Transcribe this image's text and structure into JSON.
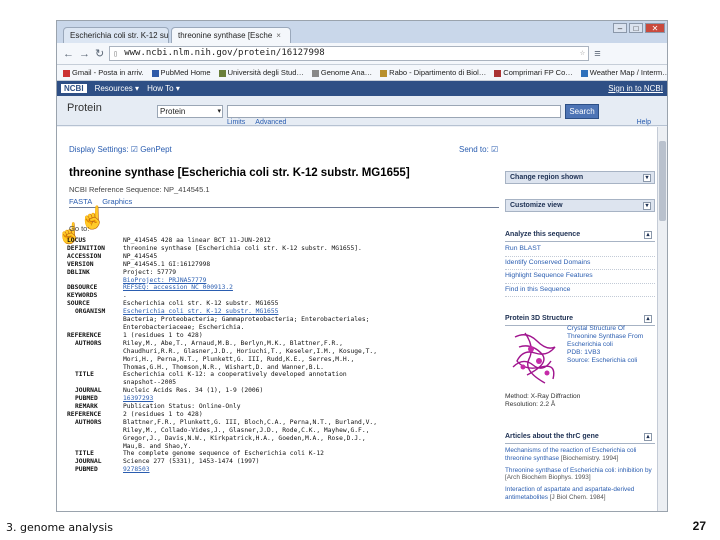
{
  "browser": {
    "tabs": [
      {
        "label": "Escherichia coli str. K-12 su",
        "active": false
      },
      {
        "label": "threonine synthase [Esche",
        "active": true
      }
    ],
    "url": "www.ncbi.nlm.nih.gov/protein/16127998",
    "window_buttons": [
      "–",
      "□",
      "✕"
    ],
    "bookmarks": [
      "Gmail - Posta in arriv.",
      "PubMed Home",
      "Università degli Stud…",
      "Genome Ana…",
      "Rabo - Dipartimento di Biol…",
      "Comprimari FP Co…",
      "Weather Map / Interm…"
    ]
  },
  "ncbi": {
    "logo": "NCBI",
    "resources": "Resources",
    "howto": "How To",
    "signin": "Sign in to NCBI",
    "db_title": "Protein",
    "db_select": "Protein",
    "search_button": "Search",
    "limits": "Limits",
    "advanced": "Advanced",
    "help": "Help"
  },
  "record": {
    "display_settings": "Display Settings: ☑ GenPept",
    "send_to": "Send to: ☑",
    "title": "threonine synthase [Escherichia coli str. K-12 substr. MG1655]",
    "ref_seq": "NCBI Reference Sequence: NP_414545.1",
    "formats": [
      "FASTA",
      "Graphics"
    ],
    "go_to": "Go to:",
    "genpept": [
      {
        "key": "LOCUS",
        "sub": false,
        "val": "NP_414545                 428 aa            linear   BCT 11-JUN-2012",
        "link": false
      },
      {
        "key": "DEFINITION",
        "sub": false,
        "val": "threonine synthase [Escherichia coli str. K-12 substr. MG1655].",
        "link": false
      },
      {
        "key": "ACCESSION",
        "sub": false,
        "val": "NP_414545",
        "link": false
      },
      {
        "key": "VERSION",
        "sub": false,
        "val": "NP_414545.1  GI:16127998",
        "link": false
      },
      {
        "key": "DBLINK",
        "sub": false,
        "val": "Project: 57779",
        "link": false
      },
      {
        "key": "",
        "sub": false,
        "val": "BioProject: PRJNA57779",
        "link": true
      },
      {
        "key": "DBSOURCE",
        "sub": false,
        "val": "REFSEQ: accession NC_000913.2",
        "link": true
      },
      {
        "key": "KEYWORDS",
        "sub": false,
        "val": ".",
        "link": false
      },
      {
        "key": "SOURCE",
        "sub": false,
        "val": "Escherichia coli str. K-12 substr. MG1655",
        "link": false
      },
      {
        "key": "ORGANISM",
        "sub": true,
        "val": "Escherichia coli str. K-12 substr. MG1655",
        "link": true
      },
      {
        "key": "",
        "sub": false,
        "val": "Bacteria; Proteobacteria; Gammaproteobacteria; Enterobacteriales;",
        "link": false
      },
      {
        "key": "",
        "sub": false,
        "val": "Enterobacteriaceae; Escherichia.",
        "link": false
      },
      {
        "key": "REFERENCE",
        "sub": false,
        "val": "1  (residues 1 to 428)",
        "link": false
      },
      {
        "key": "AUTHORS",
        "sub": true,
        "val": "Riley,M., Abe,T., Arnaud,M.B., Berlyn,M.K., Blattner,F.R.,",
        "link": false
      },
      {
        "key": "",
        "sub": false,
        "val": "Chaudhuri,R.R., Glasner,J.D., Horiuchi,T., Keseler,I.M., Kosuge,T.,",
        "link": false
      },
      {
        "key": "",
        "sub": false,
        "val": "Mori,H., Perna,N.T., Plunkett,G. III, Rudd,K.E., Serres,M.H.,",
        "link": false
      },
      {
        "key": "",
        "sub": false,
        "val": "Thomas,G.H., Thomson,N.R., Wishart,D. and Wanner,B.L.",
        "link": false
      },
      {
        "key": "TITLE",
        "sub": true,
        "val": "Escherichia coli K-12: a cooperatively developed annotation",
        "link": false
      },
      {
        "key": "",
        "sub": false,
        "val": "snapshot--2005",
        "link": false
      },
      {
        "key": "JOURNAL",
        "sub": true,
        "val": "Nucleic Acids Res. 34 (1), 1-9 (2006)",
        "link": false
      },
      {
        "key": "PUBMED",
        "sub": true,
        "val": "16397293",
        "link": true
      },
      {
        "key": "REMARK",
        "sub": true,
        "val": "Publication Status: Online-Only",
        "link": false
      },
      {
        "key": "REFERENCE",
        "sub": false,
        "val": "2  (residues 1 to 428)",
        "link": false
      },
      {
        "key": "AUTHORS",
        "sub": true,
        "val": "Blattner,F.R., Plunkett,G. III, Bloch,C.A., Perna,N.T., Burland,V.,",
        "link": false
      },
      {
        "key": "",
        "sub": false,
        "val": "Riley,M., Collado-Vides,J., Glasner,J.D., Rode,C.K., Mayhew,G.F.,",
        "link": false
      },
      {
        "key": "",
        "sub": false,
        "val": "Gregor,J., Davis,N.W., Kirkpatrick,H.A., Goeden,M.A., Rose,D.J.,",
        "link": false
      },
      {
        "key": "",
        "sub": false,
        "val": "Mau,B. and Shao,Y.",
        "link": false
      },
      {
        "key": "TITLE",
        "sub": true,
        "val": "The complete genome sequence of Escherichia coli K-12",
        "link": false
      },
      {
        "key": "JOURNAL",
        "sub": true,
        "val": "Science 277 (5331), 1453-1474 (1997)",
        "link": false
      },
      {
        "key": "PUBMED",
        "sub": true,
        "val": "9278503",
        "link": true
      }
    ]
  },
  "sidebar": {
    "change_region": "Change region shown",
    "customize_view": "Customize view",
    "analyze_head": "Analyze this sequence",
    "analyze_items": [
      "Run BLAST",
      "Identify Conserved Domains",
      "Highlight Sequence Features",
      "Find in this Sequence"
    ],
    "structure_head": "Protein 3D Structure",
    "structure_text": "Crystal Structure Of Threonine Synthase From Escherichia coli",
    "structure_pdb": "PDB: 1VB3",
    "structure_source": "Source: Escherichia coli",
    "structure_method": "Method: X-Ray Diffraction",
    "structure_resolution": "Resolution: 2.2 Å",
    "articles_head": "Articles about the thrC gene",
    "articles": [
      {
        "title": "Mechanisms of the reaction of Escherichia coli threonine synthase",
        "cite": "[Biochemistry. 1994]"
      },
      {
        "title": "Threonine synthase of Escherichia coli: inhibition by",
        "cite": "[Arch Biochem Biophys. 1993]"
      },
      {
        "title": "Interaction of aspartate and aspartate-derived antimetabolites",
        "cite": "[J Biol Chem. 1984]"
      }
    ],
    "structure_colors": {
      "background": "#ffffff",
      "molecule": "#a0148e"
    }
  },
  "slide": {
    "caption": "3. genome analysis",
    "page_number": "27"
  }
}
